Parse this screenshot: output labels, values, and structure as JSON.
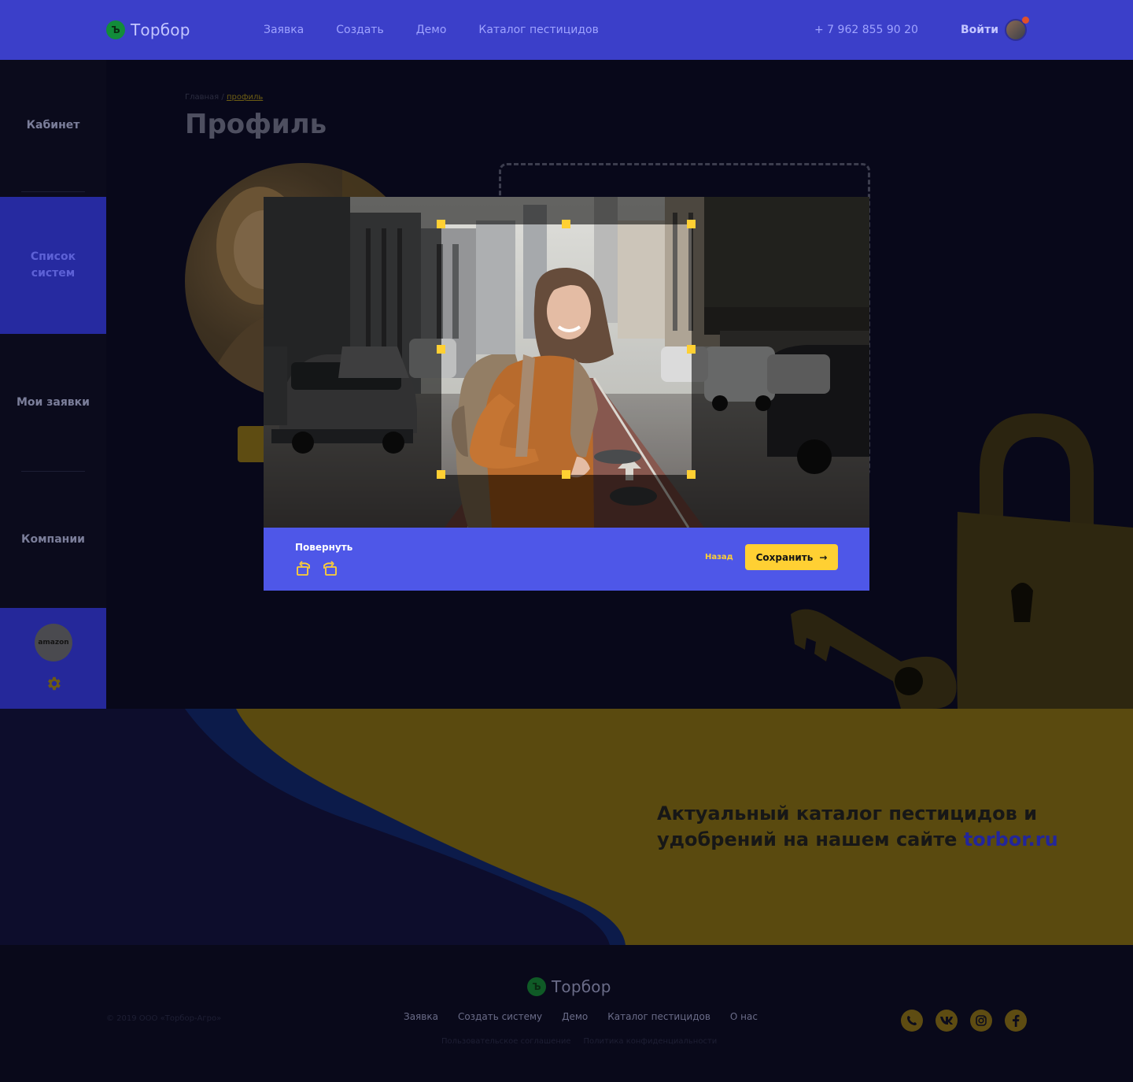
{
  "header": {
    "logo_mark": "Ъ",
    "logo_text": "Торбор",
    "nav": [
      "Заявка",
      "Создать",
      "Демо",
      "Каталог пестицидов"
    ],
    "phone": "+ 7 962 855 90 20",
    "login_label": "Войти"
  },
  "sidebar": {
    "items": [
      {
        "label": "Кабинет"
      },
      {
        "label": "Список систем"
      },
      {
        "label": "Мои заявки"
      },
      {
        "label": "Компании"
      }
    ],
    "company_logo": "amazon",
    "settings_icon": "gear-icon"
  },
  "page": {
    "breadcrumb_home": "Главная",
    "breadcrumb_sep": " / ",
    "breadcrumb_current": "профиль",
    "title": "Профиль"
  },
  "modal": {
    "rotate_label": "Повернуть",
    "rotate_left_icon": "rotate-left-icon",
    "rotate_right_icon": "rotate-right-icon",
    "back_label": "Назад",
    "save_label": "Сохранить",
    "save_arrow": "→"
  },
  "promo": {
    "text_line1": "Актуальный каталог пестицидов и",
    "text_line2": "удобрений на нашем сайте ",
    "link": "torbor.ru"
  },
  "footer": {
    "logo_mark": "Ъ",
    "logo_text": "Торбор",
    "copyright": "© 2019 ООО «Торбор-Агро»",
    "nav": [
      "Заявка",
      "Создать систему",
      "Демо",
      "Каталог пестицидов",
      "О нас"
    ],
    "legal": [
      "Пользовательское соглашение",
      "Политика конфиденциальности"
    ],
    "socials": [
      "viber-icon",
      "vk-icon",
      "instagram-icon",
      "facebook-icon"
    ]
  },
  "colors": {
    "header_bg": "#3b3fc9",
    "accent_yellow": "#ffd033",
    "modal_bar": "#4e57e8"
  }
}
